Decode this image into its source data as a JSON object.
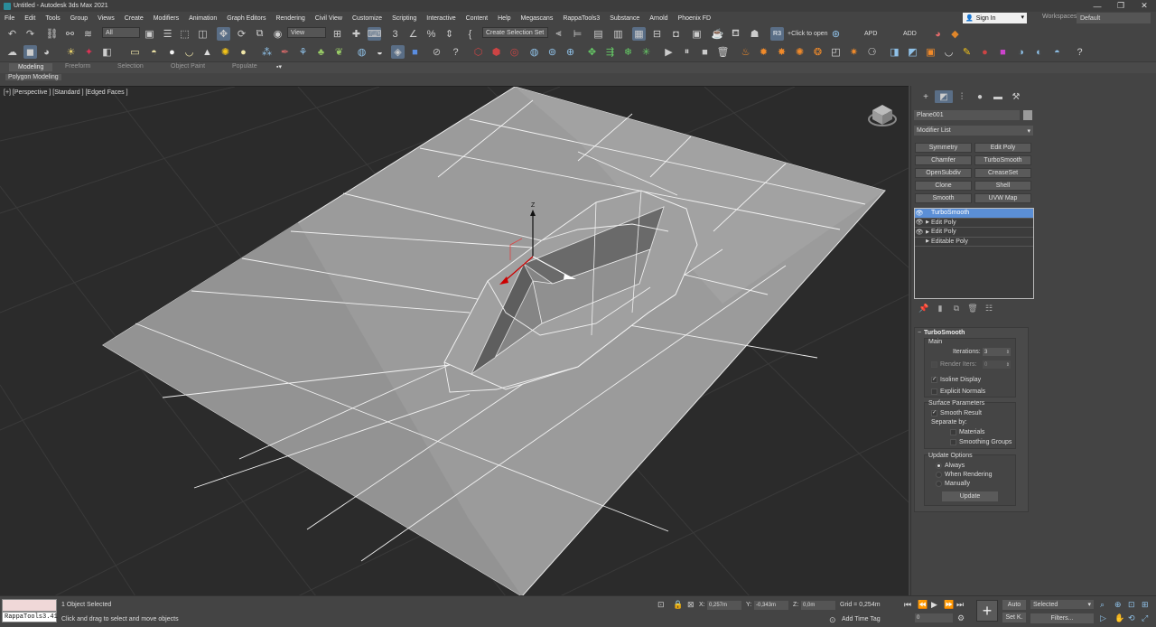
{
  "window": {
    "title": "Untitled - Autodesk 3ds Max 2021",
    "controls": [
      "—",
      "❐",
      "✕"
    ]
  },
  "menu": [
    "File",
    "Edit",
    "Tools",
    "Group",
    "Views",
    "Create",
    "Modifiers",
    "Animation",
    "Graph Editors",
    "Rendering",
    "Civil View",
    "Customize",
    "Scripting",
    "Interactive",
    "Content",
    "Help",
    "Megascans",
    "RappaTools3",
    "Substance",
    "Arnold",
    "Phoenix FD"
  ],
  "account": {
    "sign_in": "Sign In",
    "workspaces_label": "Workspaces:",
    "workspace": "Default"
  },
  "toolbar": {
    "filter": "All",
    "coord_system": "View",
    "selection_set": "Create Selection Set",
    "click_to_open": "+Click to open",
    "apd": "APD",
    "add": "ADD"
  },
  "ribbon": {
    "tabs": [
      "Modeling",
      "Freeform",
      "Selection",
      "Object Paint",
      "Populate"
    ],
    "active_tab": "Modeling",
    "panel": "Polygon Modeling"
  },
  "viewport": {
    "label": "[+] [Perspective ] [Standard ] [Edged Faces ]",
    "gizmo_axis": "Z"
  },
  "command_panel": {
    "object_name": "Plane001",
    "object_color": "#9a9a9a",
    "modifier_list": "Modifier List",
    "modifier_buttons": [
      "Symmetry",
      "Edit Poly",
      "Chamfer",
      "TurboSmooth",
      "OpenSubdiv",
      "CreaseSet",
      "Clone",
      "Shell",
      "Smooth",
      "UVW Map"
    ],
    "stack": [
      {
        "label": "TurboSmooth",
        "selected": true,
        "expandable": false
      },
      {
        "label": "Edit Poly",
        "selected": false,
        "expandable": true
      },
      {
        "label": "Edit Poly",
        "selected": false,
        "expandable": true
      },
      {
        "label": "Editable Poly",
        "selected": false,
        "expandable": true
      }
    ],
    "turbosmooth": {
      "title": "TurboSmooth",
      "main_label": "Main",
      "iterations_label": "Iterations:",
      "iterations": "3",
      "render_iters_label": "Render Iters:",
      "render_iters": "0",
      "isoline_label": "Isoline Display",
      "isoline_checked": true,
      "explicit_normals_label": "Explicit Normals",
      "explicit_normals_checked": false,
      "surface_params_label": "Surface Parameters",
      "smooth_result_label": "Smooth Result",
      "smooth_result_checked": true,
      "separate_by_label": "Separate by:",
      "materials_label": "Materials",
      "smoothing_groups_label": "Smoothing Groups",
      "update_options_label": "Update Options",
      "update_options": [
        "Always",
        "When Rendering",
        "Manually"
      ],
      "update_selected": "Always",
      "update_button": "Update"
    }
  },
  "status": {
    "script_name": "RappaTools3.41",
    "selection": "1 Object Selected",
    "prompt": "Click and drag to select and move objects",
    "x": "0,257m",
    "y": "-0,343m",
    "z": "0,0m",
    "grid": "Grid = 0,254m",
    "add_time_tag": "Add Time Tag",
    "frame": "0",
    "auto": "Auto",
    "set_k": "Set K.",
    "selected": "Selected",
    "filters": "Filters..."
  },
  "colors": {
    "selection_highlight": "#5b8fd6",
    "active_tool": "#5a6e86",
    "plane": "#9b9b9b",
    "viewport_bg": "#2b2b2b"
  }
}
